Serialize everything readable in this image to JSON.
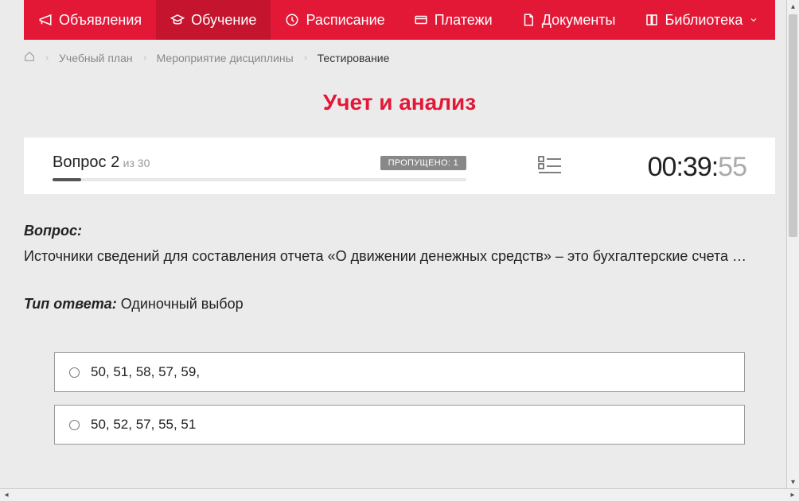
{
  "nav": {
    "items": [
      {
        "label": "Объявления",
        "icon": "megaphone"
      },
      {
        "label": "Обучение",
        "icon": "graduation",
        "active": true
      },
      {
        "label": "Расписание",
        "icon": "clock"
      },
      {
        "label": "Платежи",
        "icon": "payment"
      },
      {
        "label": "Документы",
        "icon": "document"
      },
      {
        "label": "Библиотека",
        "icon": "book",
        "dropdown": true
      }
    ]
  },
  "breadcrumb": {
    "items": [
      {
        "label": "Учебный план"
      },
      {
        "label": "Мероприятие дисциплины"
      }
    ],
    "current": "Тестирование"
  },
  "page_title": "Учет и анализ",
  "status": {
    "question_label": "Вопрос 2",
    "question_total": "из 30",
    "skipped_label": "ПРОПУЩЕНО: 1",
    "timer_main": "00:39:",
    "timer_sec": "55"
  },
  "question": {
    "heading": "Вопрос:",
    "text": "Источники сведений для составления отчета «О движении денежных средств» – это бухгалтерские счета …",
    "answer_type_label": "Тип ответа:",
    "answer_type_value": "Одиночный выбор"
  },
  "options": [
    {
      "text": "50, 51, 58, 57, 59,"
    },
    {
      "text": "50, 52, 57, 55, 51"
    }
  ]
}
